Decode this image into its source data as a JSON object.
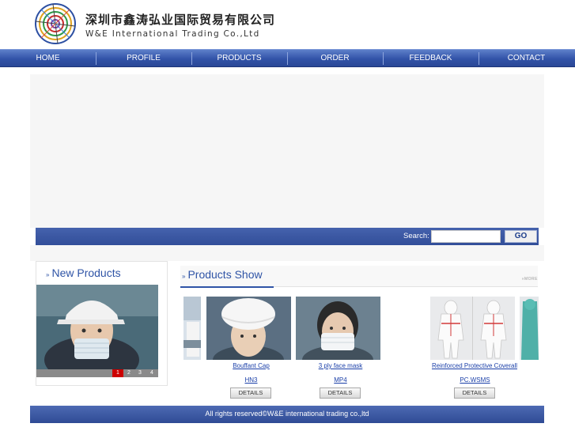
{
  "company": {
    "name_cn": "深圳市鑫涛弘业国际贸易有限公司",
    "name_en": "W&E International Trading Co.,Ltd"
  },
  "nav": [
    "HOME",
    "PROFILE",
    "PRODUCTS",
    "ORDER",
    "FEEDBACK",
    "CONTACT"
  ],
  "search": {
    "label": "Search:",
    "value": "",
    "button": "GO"
  },
  "new_products": {
    "title": "New Products",
    "pages": [
      "1",
      "2",
      "3",
      "4"
    ],
    "active_page": "1"
  },
  "products_show": {
    "title": "Products Show",
    "more": "MORE",
    "items": [
      {
        "name": "Bouffant Cap",
        "code": "HN3",
        "details": "DETAILS"
      },
      {
        "name": "3 ply face mask",
        "code": "MP4",
        "details": "DETAILS"
      },
      {
        "name": "Reinforced Protective Coverall",
        "code": "PC.WSMS",
        "details": "DETAILS"
      }
    ]
  },
  "footer": {
    "text": "All rights reserved©W&E international trading co.,ltd"
  },
  "colors": {
    "nav_blue": "#3253a8",
    "link_blue": "#1a3fa8",
    "title_blue": "#2f54a6",
    "active_page": "#cc0000"
  }
}
